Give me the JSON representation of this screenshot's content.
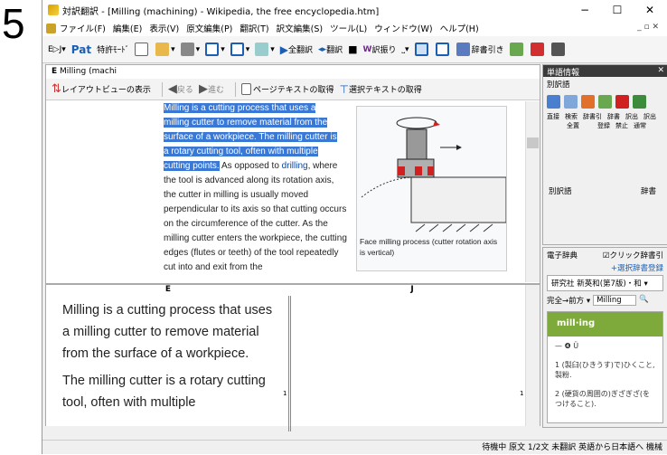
{
  "step_number": "5",
  "window": {
    "title": "対訳翻訳 - [Milling (machining) - Wikipedia, the free encyclopedia.htm]",
    "controls": {
      "minimize": "−",
      "maximize": "☐",
      "close": "✕"
    }
  },
  "menu": {
    "items": [
      "ファイル(F)",
      "編集(E)",
      "表示(V)",
      "原文編集(P)",
      "翻訳(T)",
      "訳文編集(S)",
      "ツール(L)",
      "ウィンドウ(W)",
      "ヘルプ(H)"
    ],
    "mdi_controls": "_ ▫ ✕"
  },
  "toolbar": {
    "ej_label": "E▷J",
    "pat_label": "Pat",
    "patent_mode": "特許ﾓｰﾄﾞ",
    "full_translate": "全翻訳",
    "translate": "翻訳",
    "split_translate": "訳振り",
    "dictionary_lookup": "辞書引き"
  },
  "document": {
    "tab_prefix": "E",
    "tab_label": "Milling (machi",
    "nav": {
      "layout_view": "レイアウトビューの表示",
      "back": "戻る",
      "forward": "進む",
      "get_page_text": "ページテキストの取得",
      "get_selected_text": "選択テキストの取得"
    },
    "web": {
      "highlight_segments": [
        "Milling is a cutting process that uses a",
        "milling cutter to remove material from the",
        "surface of a workpiece. The milling cutter is",
        "a rotary cutting tool, often with multiple",
        "cutting points."
      ],
      "text_after_1": " As opposed to ",
      "link_drilling": "drilling",
      "text_after_2": ", where the tool is advanced along its rotation axis, the cutter in milling is usually moved perpendicular to its axis so that cutting occurs on the circumference of the cutter. As the milling cutter enters the workpiece, the cutting edges (flutes or teeth) of the tool repeatedly cut into and exit from the",
      "image_caption": "Face milling process (cutter rotation axis is vertical)"
    },
    "bilingual": {
      "source_header": "E",
      "target_header": "J",
      "source_text_1": "Milling is a cutting process that uses a milling cutter to remove material from the surface of a workpiece.",
      "source_text_2": "The milling cutter is a rotary cutting tool, often with multiple",
      "marker_1": "1",
      "marker_2": "1"
    }
  },
  "right_panel": {
    "word_info_title": "単語情報",
    "alt_words_tab": "別訳語",
    "icon_labels": [
      "直接",
      "検索",
      "辞書引",
      "辞書",
      "訳出",
      "訳出"
    ],
    "icon_labels_2": [
      "",
      "全置",
      "",
      "登録",
      "禁止",
      "通常"
    ],
    "alt_words_label": "別訳語",
    "dict_label": "辞書",
    "e_dict_title": "電子辞典",
    "click_lookup": "クリック辞書引",
    "add_dict": "+選択辞書登録",
    "dictionary_name": "研究社 新英和(第7版)・和",
    "match_mode": "完全→前方",
    "search_value": "Milling",
    "headword": "mill·ing",
    "sense_marker": "— ❹ Ü",
    "sense_1": "1 (製臼(ひきうす)で)ひくこと, 製粉.",
    "sense_2": "2 (硬貨の周囲の)ぎざぎざ(をつけること)."
  },
  "status": {
    "text": "待機中  原文  1/2文  未翻訳  英語から日本語へ  機械"
  }
}
